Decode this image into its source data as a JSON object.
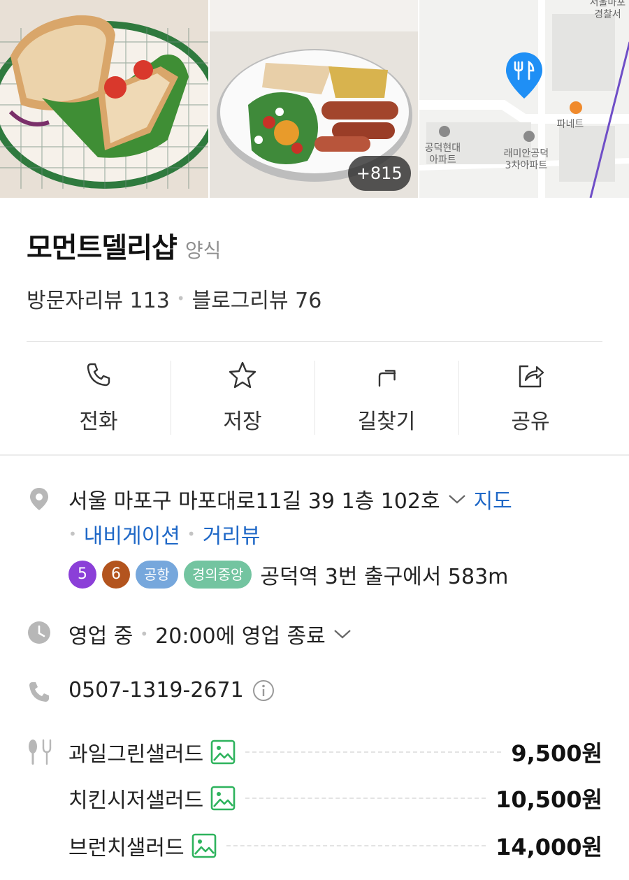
{
  "photos": {
    "more_count": "+815",
    "map_labels": [
      "서울마포",
      "경찰서",
      "파네트",
      "공덕현대",
      "아파트",
      "래미안공덕",
      "3차아파트"
    ]
  },
  "place": {
    "name": "모먼트델리샵",
    "category": "양식",
    "visitor_reviews": "방문자리뷰 113",
    "blog_reviews": "블로그리뷰 76"
  },
  "actions": [
    {
      "label": "전화",
      "icon": "phone-icon"
    },
    {
      "label": "저장",
      "icon": "star-icon"
    },
    {
      "label": "길찾기",
      "icon": "directions-icon"
    },
    {
      "label": "공유",
      "icon": "share-icon"
    }
  ],
  "address": {
    "text": "서울 마포구 마포대로11길 39 1층 102호",
    "map_link": "지도",
    "navigation_link": "내비게이션",
    "street_view_link": "거리뷰"
  },
  "subway": {
    "lines": [
      {
        "label": "5",
        "color": "#8b3fd8"
      },
      {
        "label": "6",
        "color": "#b3541e"
      }
    ],
    "pills": [
      {
        "label": "공항",
        "color": "#76a7dc"
      },
      {
        "label": "경의중앙",
        "color": "#73c4a0"
      }
    ],
    "text": "공덕역 3번 출구에서 583m"
  },
  "hours": {
    "status": "영업 중",
    "detail": "20:00에 영업 종료"
  },
  "phone": {
    "number": "0507-1319-2671"
  },
  "menu": [
    {
      "name": "과일그린샐러드",
      "price": "9,500원"
    },
    {
      "name": "치킨시저샐러드",
      "price": "10,500원"
    },
    {
      "name": "브런치샐러드",
      "price": "14,000원"
    }
  ],
  "colors": {
    "link": "#1f68c7",
    "pin": "#1f8ff5",
    "menu_photo_icon": "#2eb35d"
  }
}
